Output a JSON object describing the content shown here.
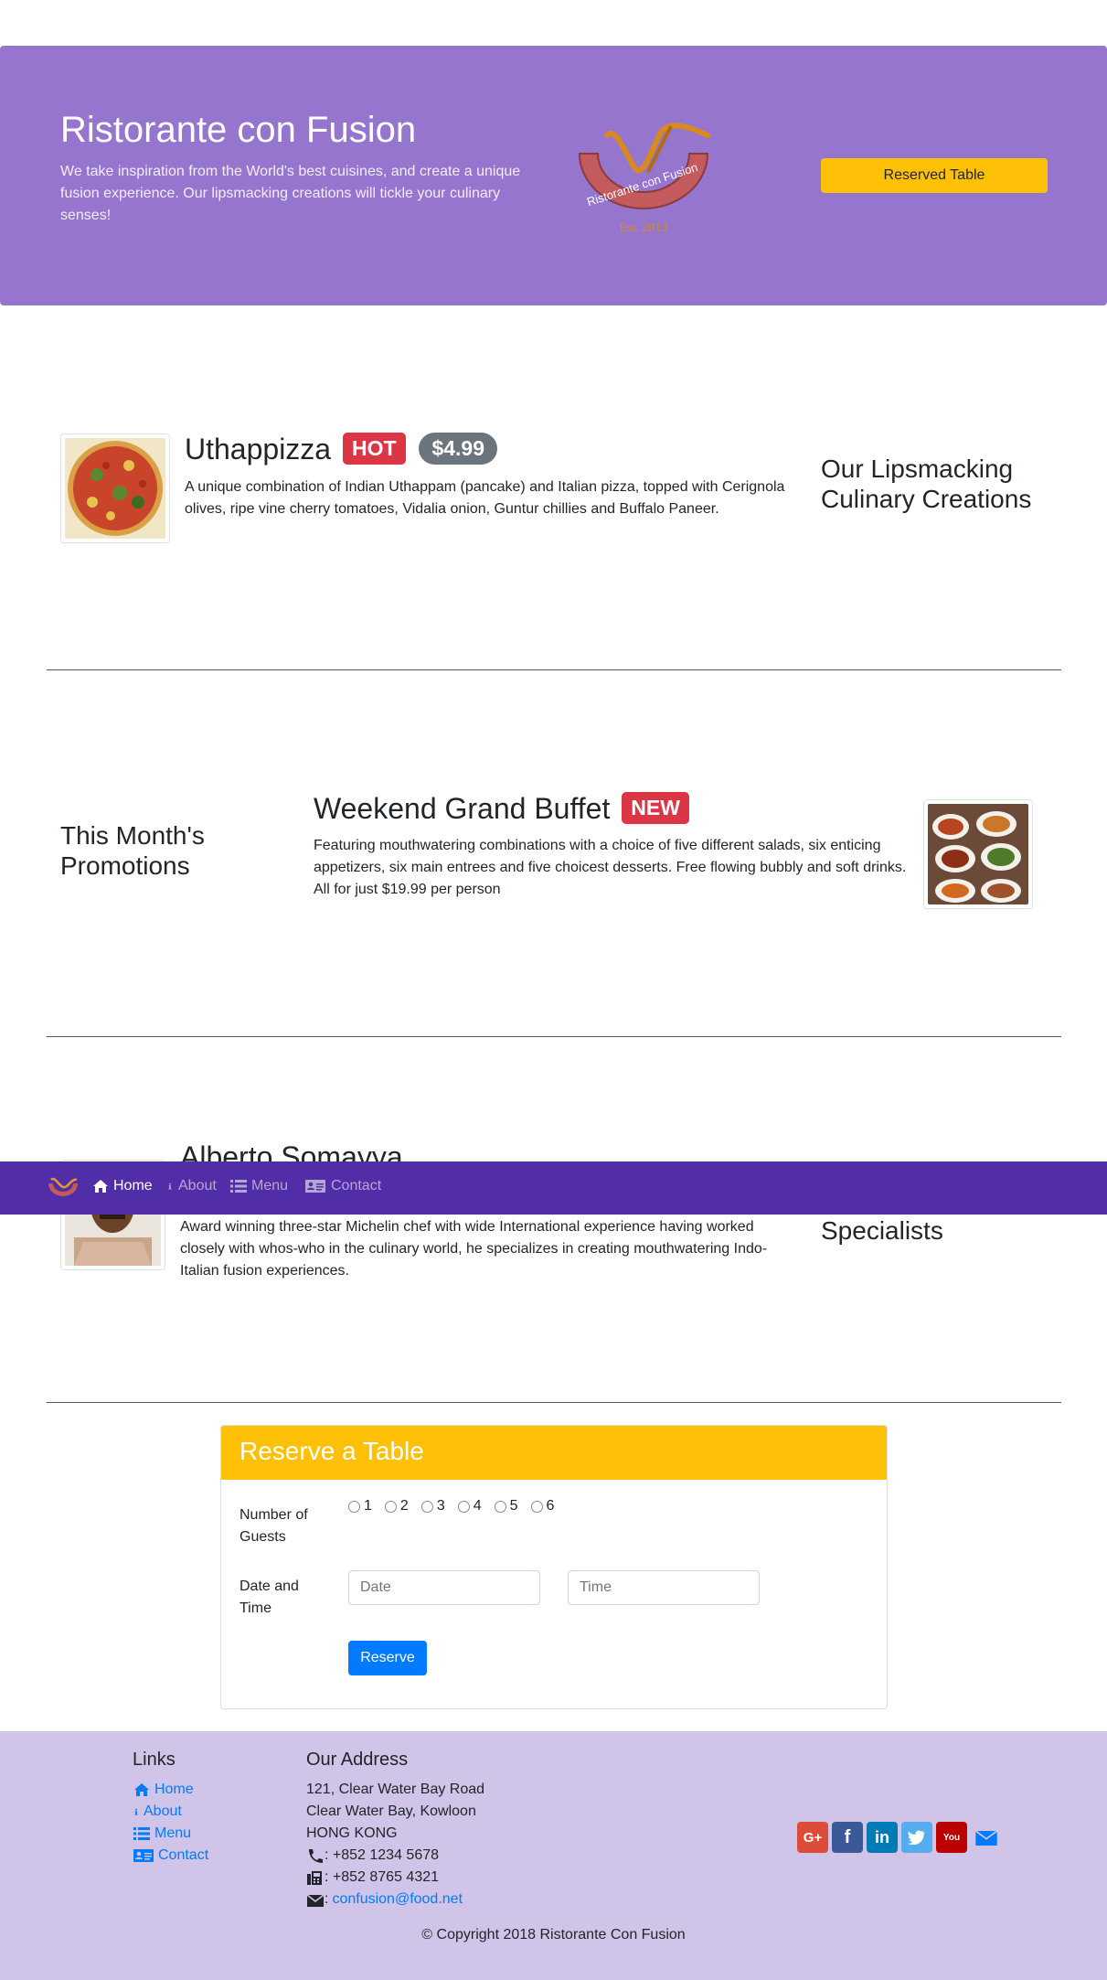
{
  "jumbotron": {
    "title": "Ristorante con Fusion",
    "text": "We take inspiration from the World's best cuisines, and create a unique fusion experience. Our lipsmacking creations will tickle your culinary senses!",
    "logo_text": "Ristorante con Fusion",
    "logo_est": "Est. 2013",
    "button_label": "Reserved Table"
  },
  "dish": {
    "name": "Uthappizza",
    "badge": "HOT",
    "price": "$4.99",
    "description": "A unique combination of Indian Uthappam (pancake) and Italian pizza, topped with Cerignola olives, ripe vine cherry tomatoes, Vidalia onion, Guntur chillies and Buffalo Paneer.",
    "side_heading": "Our Lipsmacking Culinary Creations"
  },
  "promotion": {
    "side_heading": "This Month's Promotions",
    "name": "Weekend Grand Buffet",
    "badge": "NEW",
    "description": "Featuring mouthwatering combinations with a choice of five different salads, six enticing appetizers, six main entrees and five choicest desserts. Free flowing bubbly and soft drinks. All for just $19.99 per person"
  },
  "chef": {
    "name": "Alberto Somayya",
    "description": "Award winning three-star Michelin chef with wide International experience having worked closely with whos-who in the culinary world, he specializes in creating mouthwatering Indo-Italian fusion experiences.",
    "side_heading_visible": "Specialists"
  },
  "navbar": {
    "items": [
      {
        "label": "Home",
        "icon": "home-icon",
        "active": true
      },
      {
        "label": "About",
        "icon": "info-icon",
        "active": false
      },
      {
        "label": "Menu",
        "icon": "list-icon",
        "active": false
      },
      {
        "label": "Contact",
        "icon": "address-card-icon",
        "active": false
      }
    ]
  },
  "reserve": {
    "title": "Reserve a Table",
    "guests_label": "Number of Guests",
    "guest_options": [
      "1",
      "2",
      "3",
      "4",
      "5",
      "6"
    ],
    "datetime_label": "Date and Time",
    "date_placeholder": "Date",
    "time_placeholder": "Time",
    "submit_label": "Reserve"
  },
  "footer": {
    "links_heading": "Links",
    "links": [
      {
        "label": "Home",
        "icon": "home-icon"
      },
      {
        "label": "About",
        "icon": "info-icon"
      },
      {
        "label": "Menu",
        "icon": "list-icon"
      },
      {
        "label": "Contact",
        "icon": "address-card-icon"
      }
    ],
    "address_heading": "Our Address",
    "address_lines": [
      "121, Clear Water Bay Road",
      "Clear Water Bay, Kowloon",
      "HONG KONG"
    ],
    "phone": ": +852 1234 5678",
    "fax": ": +852 8765 4321",
    "email_prefix": ":",
    "email": "confusion@food.net",
    "social": [
      {
        "icon": "google-plus-icon",
        "glyph": "G+",
        "color": "#dd4b39"
      },
      {
        "icon": "facebook-icon",
        "glyph": "f",
        "color": "#3b5998"
      },
      {
        "icon": "linkedin-icon",
        "glyph": "in",
        "color": "#007bb6"
      },
      {
        "icon": "twitter-icon",
        "glyph": "t",
        "color": "#55acee"
      },
      {
        "icon": "youtube-icon",
        "glyph": "You",
        "color": "#bb0000"
      },
      {
        "icon": "envelope-icon",
        "glyph": "",
        "color": "#007bff"
      }
    ],
    "copyright": "© Copyright 2018 Ristorante Con Fusion"
  }
}
